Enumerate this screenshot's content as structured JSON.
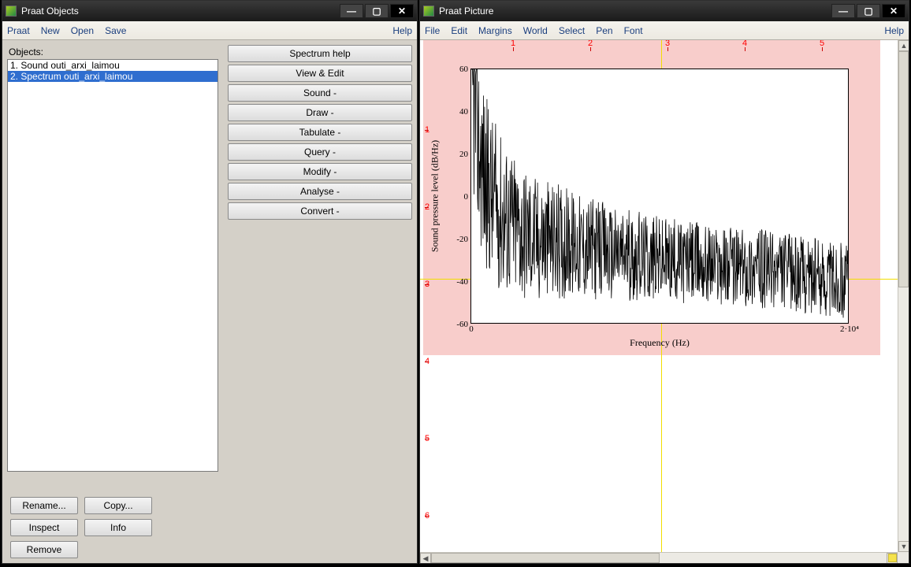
{
  "objects_window": {
    "title": "Praat Objects",
    "menu": [
      "Praat",
      "New",
      "Open",
      "Save"
    ],
    "help": "Help",
    "list_label": "Objects:",
    "items": [
      {
        "label": "1. Sound outi_arxi_laimou",
        "selected": false
      },
      {
        "label": "2. Spectrum outi_arxi_laimou",
        "selected": true
      }
    ],
    "actions": [
      "Spectrum help",
      "View & Edit",
      "Sound -",
      "Draw -",
      "Tabulate -",
      "Query -",
      "Modify -",
      "Analyse -",
      "Convert -"
    ],
    "bottom": {
      "rename": "Rename...",
      "copy": "Copy...",
      "inspect": "Inspect",
      "info": "Info",
      "remove": "Remove"
    }
  },
  "picture_window": {
    "title": "Praat Picture",
    "menu": [
      "File",
      "Edit",
      "Margins",
      "World",
      "Select",
      "Pen",
      "Font"
    ],
    "help": "Help",
    "ruler_top": [
      "1",
      "2",
      "3",
      "4",
      "5"
    ],
    "ruler_left": [
      "1",
      "2",
      "3",
      "4",
      "5",
      "6"
    ]
  },
  "chart_data": {
    "type": "line",
    "title": "",
    "xlabel": "Frequency (Hz)",
    "ylabel": "Sound pressure level (dB/Hz)",
    "xlim": [
      0,
      20000
    ],
    "ylim": [
      -60,
      60
    ],
    "x_ticks": [
      {
        "v": 0,
        "label": "0"
      },
      {
        "v": 20000,
        "label": "2·10⁴"
      }
    ],
    "y_ticks": [
      -60,
      -40,
      -20,
      0,
      20,
      40,
      60
    ],
    "series": [
      {
        "name": "spectrum",
        "x": [
          0,
          100,
          200,
          300,
          500,
          800,
          1200,
          1800,
          2500,
          3500,
          5000,
          7000,
          10000,
          13000,
          16000,
          20000
        ],
        "values": [
          55,
          45,
          40,
          30,
          18,
          6,
          -3,
          -10,
          -15,
          -20,
          -22,
          -26,
          -30,
          -32,
          -35,
          -40
        ]
      }
    ],
    "guides": {
      "vertical_x": 12500,
      "horizontal_y": -40
    }
  }
}
